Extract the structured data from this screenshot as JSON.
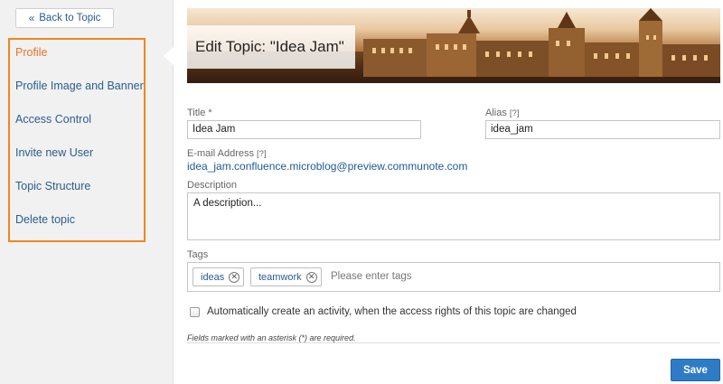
{
  "sidebar": {
    "back_label": "Back to Topic",
    "items": [
      {
        "label": "Profile",
        "active": true
      },
      {
        "label": "Profile Image and Banner",
        "active": false
      },
      {
        "label": "Access Control",
        "active": false
      },
      {
        "label": "Invite new User",
        "active": false
      },
      {
        "label": "Topic Structure",
        "active": false
      },
      {
        "label": "Delete topic",
        "active": false
      }
    ]
  },
  "header": {
    "title": "Edit Topic: \"Idea Jam\""
  },
  "form": {
    "title_label": "Title *",
    "title_value": "Idea Jam",
    "alias_label": "Alias",
    "alias_hint": "[?]",
    "alias_value": "idea_jam",
    "email_label": "E-mail Address",
    "email_hint": "[?]",
    "email_value": "idea_jam.confluence.microblog@preview.communote.com",
    "description_label": "Description",
    "description_value": "A description...",
    "tags_label": "Tags",
    "tags": [
      {
        "label": "ideas"
      },
      {
        "label": "teamwork"
      }
    ],
    "tags_placeholder": "Please enter tags",
    "activity_checkbox_label": "Automatically create an activity, when the access rights of this topic are changed",
    "activity_checked": false,
    "required_note": "Fields marked with an asterisk (*) are required.",
    "save_label": "Save"
  },
  "colors": {
    "accent": "#f0861e",
    "link": "#2a5d8f",
    "primary_button": "#2f7cc6"
  }
}
